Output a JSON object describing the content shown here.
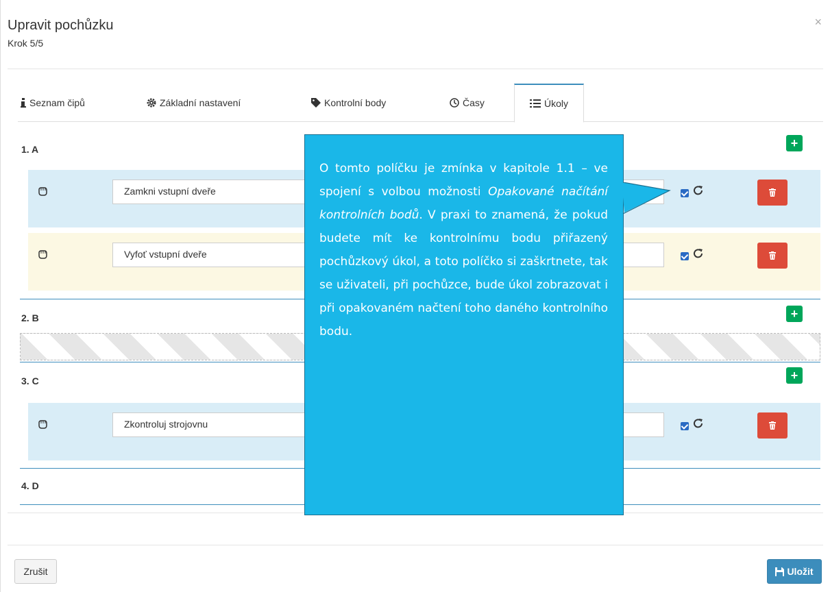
{
  "dialog": {
    "title": "Upravit pochůzku",
    "step": "Krok 5/5",
    "close_label": "×"
  },
  "tabs": [
    {
      "label": "Seznam čipů",
      "icon": "info-icon"
    },
    {
      "label": "Základní nastavení",
      "icon": "gear-icon"
    },
    {
      "label": "Kontrolní body",
      "icon": "tag-icon"
    },
    {
      "label": "Časy",
      "icon": "clock-icon"
    },
    {
      "label": "Úkoly",
      "icon": "list-icon",
      "active": true
    }
  ],
  "sections": [
    {
      "label": "1. A",
      "tasks": [
        {
          "text": "Zamkni vstupní dveře",
          "checked": true
        },
        {
          "text": "Vyfoť vstupní dveře",
          "checked": true
        }
      ]
    },
    {
      "label": "2. B",
      "tasks": []
    },
    {
      "label": "3. C",
      "tasks": [
        {
          "text": "Zkontroluj strojovnu",
          "checked": true
        }
      ]
    },
    {
      "label": "4. D",
      "tasks": []
    }
  ],
  "callout": {
    "part1": "O tomto políčku je zmínka v kapitole 1.1 – ve spojení s volbou možnosti ",
    "italic": "Opakované načítání kontrolních bodů",
    "part2": ". V praxi to znamená, že pokud budete mít ke kontrolnímu bodu přiřazený pochůzkový úkol, a toto políčko si zaškrtnete, tak se uživateli, při pochůzce, bude úkol zobrazovat i při opakovaném načtení toho daného kontrolního bodu."
  },
  "footer": {
    "cancel_label": "Zrušit",
    "save_label": "Uložit"
  },
  "colors": {
    "tab_active_border": "#3c8dbc",
    "add_button": "#00a65a",
    "delete_button": "#dd4b39",
    "row_blue": "#d9edf7",
    "row_yellow": "#fcf8e3",
    "callout_bg": "#1ab7e8",
    "save_button": "#3c8dbc"
  }
}
